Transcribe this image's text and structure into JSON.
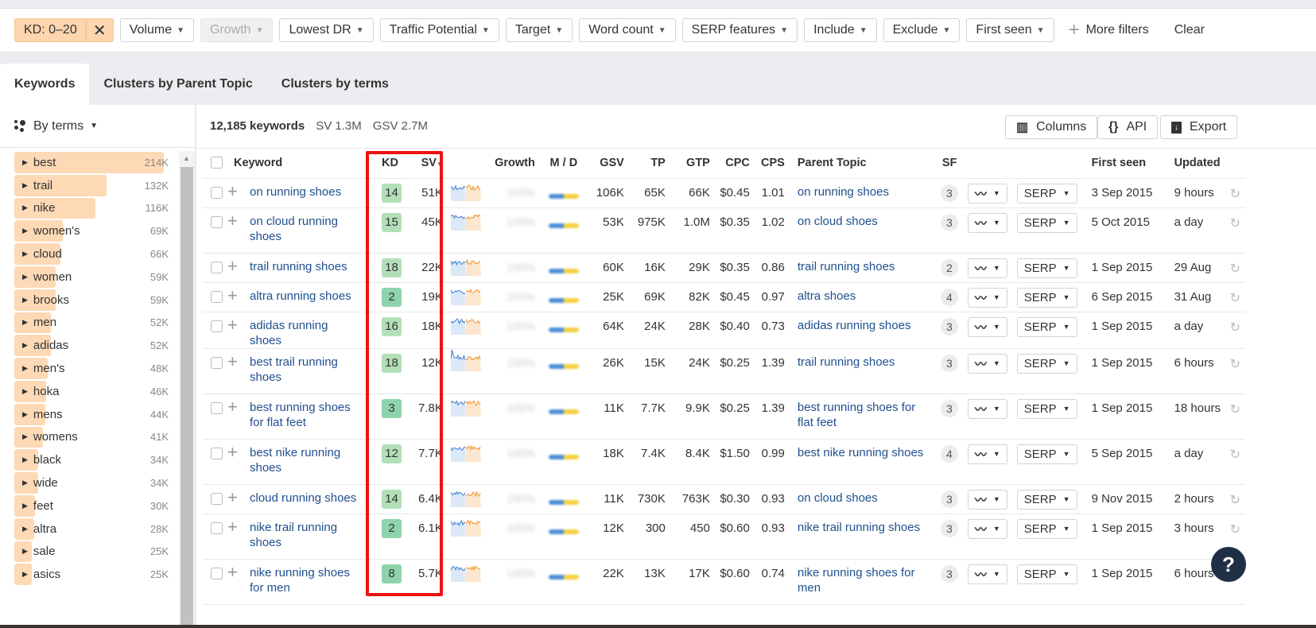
{
  "filters": {
    "active_chip": "KD: 0–20",
    "items": [
      {
        "label": "Volume",
        "disabled": false
      },
      {
        "label": "Growth",
        "disabled": true
      },
      {
        "label": "Lowest DR",
        "disabled": false
      },
      {
        "label": "Traffic Potential",
        "disabled": false
      },
      {
        "label": "Target",
        "disabled": false
      },
      {
        "label": "Word count",
        "disabled": false
      },
      {
        "label": "SERP features",
        "disabled": false
      },
      {
        "label": "Include",
        "disabled": false
      },
      {
        "label": "Exclude",
        "disabled": false
      },
      {
        "label": "First seen",
        "disabled": false
      }
    ],
    "more_filters": "More filters",
    "clear": "Clear"
  },
  "tabs": [
    {
      "label": "Keywords",
      "active": true
    },
    {
      "label": "Clusters by Parent Topic",
      "active": false
    },
    {
      "label": "Clusters by terms",
      "active": false
    }
  ],
  "sidebar": {
    "mode": "By terms",
    "max": 214,
    "terms": [
      {
        "name": "best",
        "count": "214K",
        "value": 214
      },
      {
        "name": "trail",
        "count": "132K",
        "value": 132
      },
      {
        "name": "nike",
        "count": "116K",
        "value": 116
      },
      {
        "name": "women's",
        "count": "69K",
        "value": 69
      },
      {
        "name": "cloud",
        "count": "66K",
        "value": 66
      },
      {
        "name": "women",
        "count": "59K",
        "value": 59
      },
      {
        "name": "brooks",
        "count": "59K",
        "value": 59
      },
      {
        "name": "men",
        "count": "52K",
        "value": 52
      },
      {
        "name": "adidas",
        "count": "52K",
        "value": 52
      },
      {
        "name": "men's",
        "count": "48K",
        "value": 48
      },
      {
        "name": "hoka",
        "count": "46K",
        "value": 46
      },
      {
        "name": "mens",
        "count": "44K",
        "value": 44
      },
      {
        "name": "womens",
        "count": "41K",
        "value": 41
      },
      {
        "name": "black",
        "count": "34K",
        "value": 34
      },
      {
        "name": "wide",
        "count": "34K",
        "value": 34
      },
      {
        "name": "feet",
        "count": "30K",
        "value": 30
      },
      {
        "name": "altra",
        "count": "28K",
        "value": 28
      },
      {
        "name": "sale",
        "count": "25K",
        "value": 25
      },
      {
        "name": "asics",
        "count": "25K",
        "value": 25
      }
    ]
  },
  "summary": {
    "keywords": "12,185 keywords",
    "sv": "SV 1.3M",
    "gsv": "GSV 2.7M"
  },
  "toolbar": {
    "columns": "Columns",
    "api": "API",
    "export": "Export"
  },
  "table": {
    "headers": {
      "keyword": "Keyword",
      "kd": "KD",
      "sv": "SV",
      "growth": "Growth",
      "md": "M / D",
      "gsv": "GSV",
      "tp": "TP",
      "gtp": "GTP",
      "cpc": "CPC",
      "cps": "CPS",
      "parent": "Parent Topic",
      "sf": "SF",
      "first_seen": "First seen",
      "updated": "Updated"
    },
    "serp_label": "SERP",
    "growth_blurred": "100%",
    "rows": [
      {
        "keyword": "on running shoes",
        "kd": 14,
        "sv": "51K",
        "gsv": "106K",
        "tp": "65K",
        "gtp": "66K",
        "cpc": "$0.45",
        "cps": "1.01",
        "parent": "on running shoes",
        "sf": 3,
        "first_seen": "3 Sep 2015",
        "updated": "9 hours"
      },
      {
        "keyword": "on cloud running shoes",
        "kd": 15,
        "sv": "45K",
        "gsv": "53K",
        "tp": "975K",
        "gtp": "1.0M",
        "cpc": "$0.35",
        "cps": "1.02",
        "parent": "on cloud shoes",
        "sf": 3,
        "first_seen": "5 Oct 2015",
        "updated": "a day"
      },
      {
        "keyword": "trail running shoes",
        "kd": 18,
        "sv": "22K",
        "gsv": "60K",
        "tp": "16K",
        "gtp": "29K",
        "cpc": "$0.35",
        "cps": "0.86",
        "parent": "trail running shoes",
        "sf": 2,
        "first_seen": "1 Sep 2015",
        "updated": "29 Aug"
      },
      {
        "keyword": "altra running shoes",
        "kd": 2,
        "sv": "19K",
        "gsv": "25K",
        "tp": "69K",
        "gtp": "82K",
        "cpc": "$0.45",
        "cps": "0.97",
        "parent": "altra shoes",
        "sf": 4,
        "first_seen": "6 Sep 2015",
        "updated": "31 Aug"
      },
      {
        "keyword": "adidas running shoes",
        "kd": 16,
        "sv": "18K",
        "gsv": "64K",
        "tp": "24K",
        "gtp": "28K",
        "cpc": "$0.40",
        "cps": "0.73",
        "parent": "adidas running shoes",
        "sf": 3,
        "first_seen": "1 Sep 2015",
        "updated": "a day"
      },
      {
        "keyword": "best trail running shoes",
        "kd": 18,
        "sv": "12K",
        "gsv": "26K",
        "tp": "15K",
        "gtp": "24K",
        "cpc": "$0.25",
        "cps": "1.39",
        "parent": "trail running shoes",
        "sf": 3,
        "first_seen": "1 Sep 2015",
        "updated": "6 hours"
      },
      {
        "keyword": "best running shoes for flat feet",
        "kd": 3,
        "sv": "7.8K",
        "gsv": "11K",
        "tp": "7.7K",
        "gtp": "9.9K",
        "cpc": "$0.25",
        "cps": "1.39",
        "parent": "best running shoes for flat feet",
        "sf": 3,
        "first_seen": "1 Sep 2015",
        "updated": "18 hours"
      },
      {
        "keyword": "best nike running shoes",
        "kd": 12,
        "sv": "7.7K",
        "gsv": "18K",
        "tp": "7.4K",
        "gtp": "8.4K",
        "cpc": "$1.50",
        "cps": "0.99",
        "parent": "best nike running shoes",
        "sf": 4,
        "first_seen": "5 Sep 2015",
        "updated": "a day"
      },
      {
        "keyword": "cloud running shoes",
        "kd": 14,
        "sv": "6.4K",
        "gsv": "11K",
        "tp": "730K",
        "gtp": "763K",
        "cpc": "$0.30",
        "cps": "0.93",
        "parent": "on cloud shoes",
        "sf": 3,
        "first_seen": "9 Nov 2015",
        "updated": "2 hours"
      },
      {
        "keyword": "nike trail running shoes",
        "kd": 2,
        "sv": "6.1K",
        "gsv": "12K",
        "tp": "300",
        "gtp": "450",
        "cpc": "$0.60",
        "cps": "0.93",
        "parent": "nike trail running shoes",
        "sf": 3,
        "first_seen": "1 Sep 2015",
        "updated": "3 hours"
      },
      {
        "keyword": "nike running shoes for men",
        "kd": 8,
        "sv": "5.7K",
        "gsv": "22K",
        "tp": "13K",
        "gtp": "17K",
        "cpc": "$0.60",
        "cps": "0.74",
        "parent": "nike running shoes for men",
        "sf": 3,
        "first_seen": "1 Sep 2015",
        "updated": "6 hours"
      }
    ]
  },
  "colors": {
    "kd_light": "#b3dfb8",
    "kd_mid": "#8fd3aa",
    "link": "#1f4f8e",
    "chip": "#fdd5ae",
    "highlight": "#ee1111"
  },
  "help_label": "?"
}
